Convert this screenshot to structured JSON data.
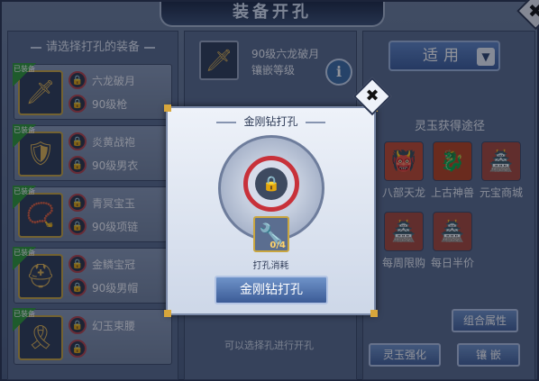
{
  "window": {
    "title": "装备开孔",
    "close_glyph": "✖"
  },
  "left": {
    "header": "请选择打孔的装备",
    "equipped_tag": "已装备",
    "items": [
      {
        "icon": "sword-icon",
        "glyph": "🗡",
        "name": "六龙破月",
        "level": "90级枪"
      },
      {
        "icon": "armor-icon",
        "glyph": "🛡",
        "name": "炎黄战袍",
        "level": "90级男衣"
      },
      {
        "icon": "necklace-icon",
        "glyph": "📿",
        "name": "青冥宝玉",
        "level": "90级项链"
      },
      {
        "icon": "helmet-icon",
        "glyph": "⛑",
        "name": "金鳞宝冠",
        "level": "90级男帽"
      },
      {
        "icon": "belt-icon",
        "glyph": "🎗",
        "name": "幻玉束腰",
        "level": ""
      }
    ]
  },
  "middle": {
    "item_name": "90级六龙破月",
    "item_sub": "镶嵌等级",
    "info_glyph": "i",
    "footer_text": "可以选择孔进行开孔"
  },
  "right": {
    "apply_label": "适用",
    "chev_glyph": "▼",
    "source_title": "灵玉获得途径",
    "sources": [
      {
        "label": "八部天龙",
        "glyph": "👹",
        "color": "#c44a2e"
      },
      {
        "label": "上古神兽",
        "glyph": "🐉",
        "color": "#b8421e"
      },
      {
        "label": "元宝商城",
        "glyph": "🏯",
        "color": "#a8473a"
      },
      {
        "label": "每周限购",
        "glyph": "🏯",
        "color": "#a8473a"
      },
      {
        "label": "每日半价",
        "glyph": "🏯",
        "color": "#a8473a"
      }
    ],
    "combo_button": "组合属性",
    "jade_button": "灵玉强化",
    "inlay_button": "镶 嵌"
  },
  "modal": {
    "title": "金刚钻打孔",
    "close_glyph": "✖",
    "lock_glyph": "🔒",
    "drill_glyph": "🔧",
    "drill_count": "0/4",
    "drill_label": "打孔消耗",
    "action_button": "金刚钻打孔"
  }
}
